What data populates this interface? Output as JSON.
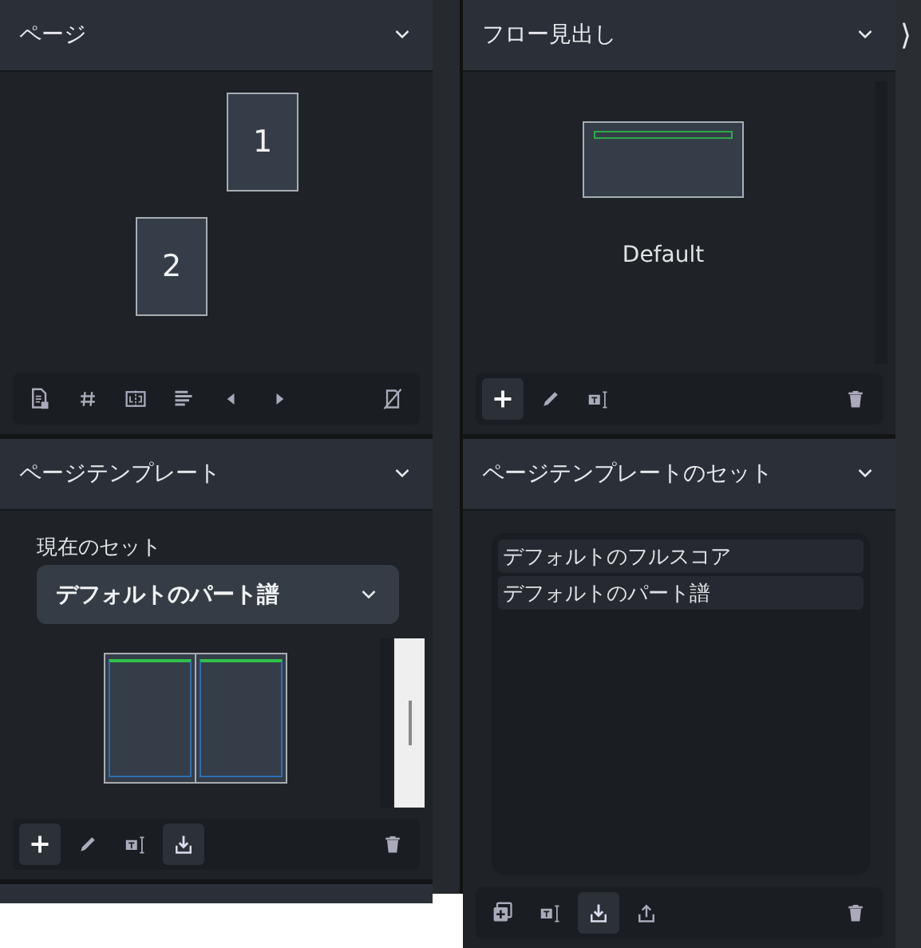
{
  "pages_panel": {
    "title": "ページ",
    "pages": [
      {
        "number": "1"
      },
      {
        "number": "2"
      }
    ],
    "tools": [
      {
        "kind": "page-info",
        "selected": false
      },
      {
        "kind": "hash",
        "selected": false
      },
      {
        "kind": "spread",
        "selected": false
      },
      {
        "kind": "align",
        "selected": false
      },
      {
        "kind": "prev",
        "selected": false
      },
      {
        "kind": "next",
        "selected": false
      },
      {
        "kind": "unlink",
        "selected": false
      }
    ]
  },
  "templates_panel": {
    "title": "ページテンプレート",
    "set_label": "現在のセット",
    "set_value": "デフォルトのパート譜",
    "tools": [
      {
        "kind": "add",
        "selected": true
      },
      {
        "kind": "edit",
        "selected": false
      },
      {
        "kind": "rename",
        "selected": false
      },
      {
        "kind": "import",
        "selected": true
      },
      {
        "kind": "delete",
        "selected": false
      }
    ]
  },
  "flow_panel": {
    "title": "フロー見出し",
    "items": [
      {
        "name": "Default"
      }
    ],
    "tools": [
      {
        "kind": "add",
        "selected": true
      },
      {
        "kind": "edit",
        "selected": false
      },
      {
        "kind": "rename",
        "selected": false
      },
      {
        "kind": "delete",
        "selected": false
      }
    ]
  },
  "sets_panel": {
    "title": "ページテンプレートのセット",
    "items": [
      {
        "name": "デフォルトのフルスコア"
      },
      {
        "name": "デフォルトのパート譜"
      }
    ],
    "tools": [
      {
        "kind": "duplicate",
        "selected": false
      },
      {
        "kind": "rename",
        "selected": false
      },
      {
        "kind": "import",
        "selected": true
      },
      {
        "kind": "export",
        "selected": false
      },
      {
        "kind": "delete",
        "selected": false
      }
    ]
  },
  "side_strip": {
    "glyph": "⟩"
  }
}
